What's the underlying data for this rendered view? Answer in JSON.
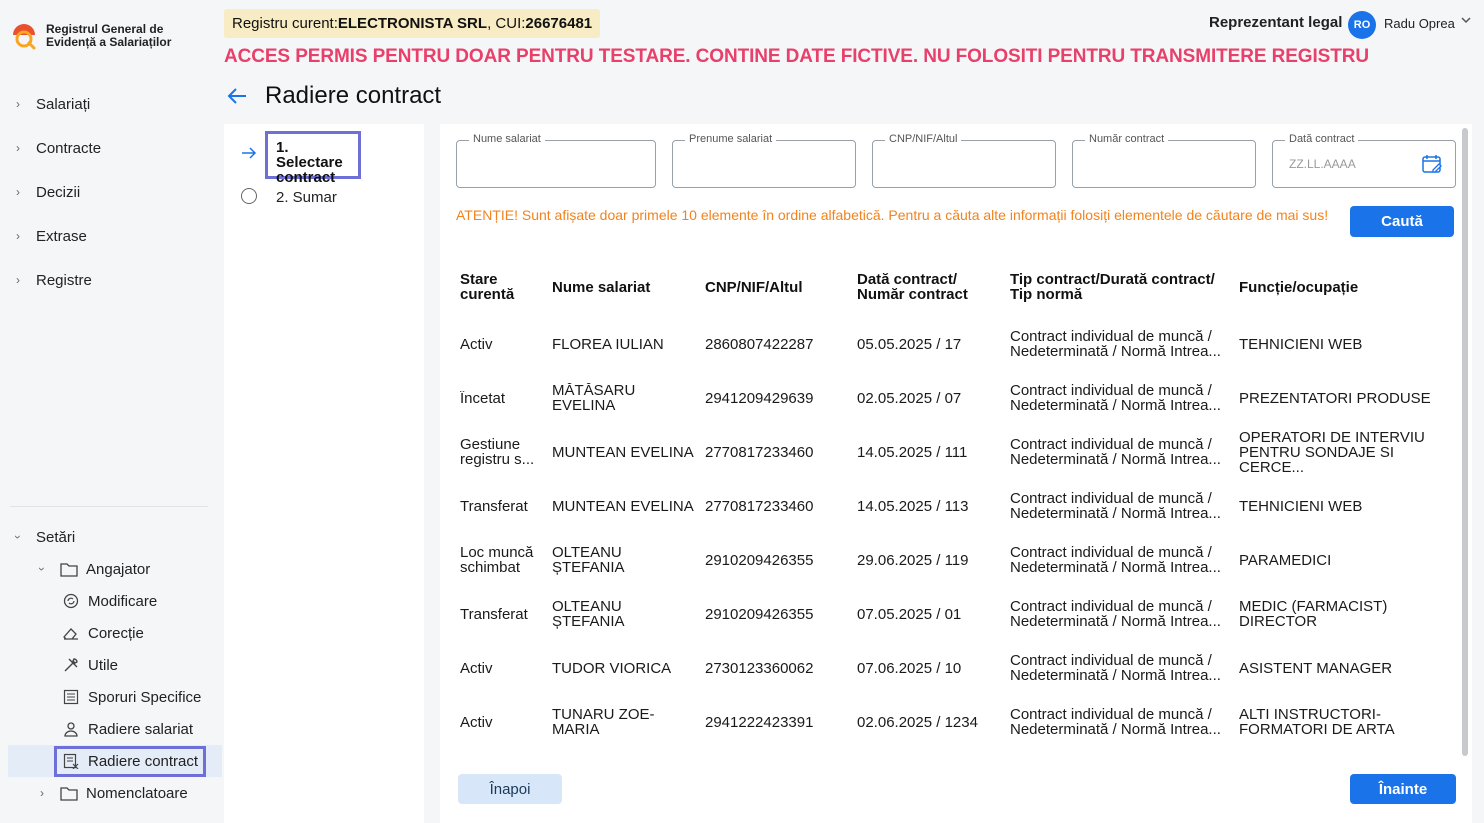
{
  "app": {
    "name": "Registrul General de Evidență a Salariaților"
  },
  "header": {
    "registry_prefix": "Registru curent: ",
    "registry_company": "ELECTRONISTA SRL",
    "registry_cui_prefix": ", CUI: ",
    "registry_cui": "26676481",
    "warning": "ACCES PERMIS PENTRU DOAR PENTRU TESTARE. CONTINE DATE FICTIVE. NU FOLOSITI PENTRU TRANSMITERE REGISTRU",
    "role": "Reprezentant legal",
    "avatar_initials": "RO",
    "user_name": "Radu Oprea"
  },
  "sidebar": {
    "items": [
      {
        "label": "Salariați"
      },
      {
        "label": "Contracte"
      },
      {
        "label": "Decizii"
      },
      {
        "label": "Extrase"
      },
      {
        "label": "Registre"
      }
    ],
    "settings": {
      "label": "Setări",
      "angajator": "Angajator",
      "sub": [
        {
          "label": "Modificare",
          "icon": "modify-icon"
        },
        {
          "label": "Corecție",
          "icon": "eraser-icon"
        },
        {
          "label": "Utile",
          "icon": "tools-icon"
        },
        {
          "label": "Sporuri Specifice",
          "icon": "list-icon"
        },
        {
          "label": "Radiere salariat",
          "icon": "user-icon"
        },
        {
          "label": "Radiere contract",
          "icon": "contract-delete-icon"
        }
      ],
      "nomenclatoare": "Nomenclatoare"
    }
  },
  "page": {
    "title": "Radiere contract"
  },
  "stepper": {
    "step1": "1. Selectare contract",
    "step2": "2. Sumar"
  },
  "search": {
    "nume_label": "Nume salariat",
    "prenume_label": "Prenume salariat",
    "cnp_label": "CNP/NIF/Altul",
    "nr_contract_label": "Număr contract",
    "data_label": "Dată contract",
    "data_placeholder": "ZZ.LL.AAAA",
    "search_button": "Caută",
    "attention": "ATENȚIE! Sunt afișate doar primele 10 elemente în ordine alfabetică. Pentru a căuta alte informații folosiți elementele de căutare de mai sus!"
  },
  "table": {
    "headers": [
      "Stare curentă",
      "Nume salariat",
      "CNP/NIF/Altul",
      "Dată contract/ Număr contract",
      "Tip contract/Durată contract/ Tip normă",
      "Funcție/ocupație"
    ],
    "rows": [
      [
        "Activ",
        "FLOREA IULIAN",
        "2860807422287",
        "05.05.2025 / 17",
        "Contract individual de muncă / Nedeterminată / Normă Intrea...",
        "TEHNICIENI WEB"
      ],
      [
        "Încetat",
        "MĂTĂSARU EVELINA",
        "2941209429639",
        "02.05.2025 / 07",
        "Contract individual de muncă / Nedeterminată / Normă Intrea...",
        "PREZENTATORI PRODUSE"
      ],
      [
        "Gestiune registru s...",
        "MUNTEAN EVELINA",
        "2770817233460",
        "14.05.2025 / 111",
        "Contract individual de muncă / Nedeterminată / Normă Intrea...",
        "OPERATORI DE INTERVIU PENTRU SONDAJE SI CERCE..."
      ],
      [
        "Transferat",
        "MUNTEAN EVELINA",
        "2770817233460",
        "14.05.2025 / 113",
        "Contract individual de muncă / Nedeterminată / Normă Intrea...",
        "TEHNICIENI WEB"
      ],
      [
        "Loc muncă schimbat",
        "OLTEANU ȘTEFANIA",
        "2910209426355",
        "29.06.2025 / 119",
        "Contract individual de muncă / Nedeterminată / Normă Intrea...",
        "PARAMEDICI"
      ],
      [
        "Transferat",
        "OLTEANU ȘTEFANIA",
        "2910209426355",
        "07.05.2025 / 01",
        "Contract individual de muncă / Nedeterminată / Normă Intrea...",
        "MEDIC (FARMACIST) DIRECTOR"
      ],
      [
        "Activ",
        "TUDOR VIORICA",
        "2730123360062",
        "07.06.2025 / 10",
        "Contract individual de muncă / Nedeterminată / Normă Intrea...",
        "ASISTENT MANAGER"
      ],
      [
        "Activ",
        "TUNARU ZOE-MARIA",
        "2941222423391",
        "02.06.2025 / 1234",
        "Contract individual de muncă / Nedeterminată / Normă Intrea...",
        "ALTI INSTRUCTORI-FORMATORI DE ARTA"
      ]
    ]
  },
  "footer": {
    "back": "Înapoi",
    "next": "Înainte"
  },
  "colors": {
    "accent": "#1a73e8",
    "warning": "#e8406a",
    "attention": "#f2831c",
    "highlight_box": "#6f6fd8"
  }
}
